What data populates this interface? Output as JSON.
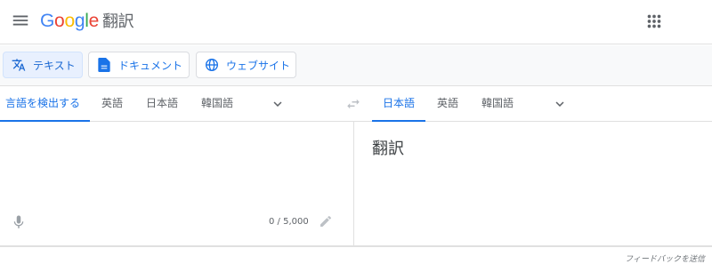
{
  "header": {
    "logo_letters": [
      "G",
      "o",
      "o",
      "g",
      "l",
      "e"
    ],
    "logo_colors": [
      "#4285f4",
      "#ea4335",
      "#fbbc05",
      "#4285f4",
      "#34a853",
      "#ea4335"
    ],
    "product_name": "翻訳",
    "menu_icon": "hamburger-menu-icon",
    "apps_icon": "apps-grid-icon"
  },
  "modes": [
    {
      "label": "テキスト",
      "icon": "translate-icon",
      "active": true
    },
    {
      "label": "ドキュメント",
      "icon": "document-icon",
      "active": false
    },
    {
      "label": "ウェブサイト",
      "icon": "globe-icon",
      "active": false
    }
  ],
  "source_languages": [
    {
      "label": "言語を検出する",
      "active": true
    },
    {
      "label": "英語",
      "active": false
    },
    {
      "label": "日本語",
      "active": false
    },
    {
      "label": "韓国語",
      "active": false
    }
  ],
  "target_languages": [
    {
      "label": "日本語",
      "active": true
    },
    {
      "label": "英語",
      "active": false
    },
    {
      "label": "韓国語",
      "active": false
    }
  ],
  "source": {
    "char_count": "0 / 5,000"
  },
  "target": {
    "output_text": "翻訳"
  },
  "feedback_label": "フィードバックを送信",
  "colors": {
    "accent": "#1a73e8",
    "active_mode_bg": "#e8f0fe",
    "divider": "#e0e0e0"
  }
}
